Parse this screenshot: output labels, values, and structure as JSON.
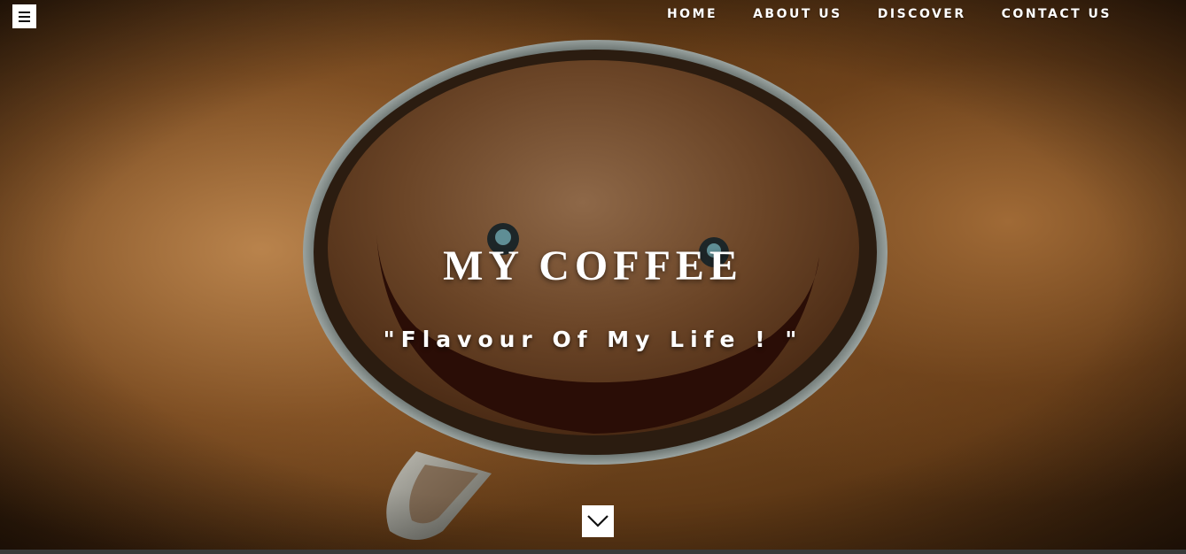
{
  "header": {
    "menu_icon": "hamburger-icon",
    "nav": [
      {
        "label": "HOME"
      },
      {
        "label": "ABOUT US"
      },
      {
        "label": "DISCOVER"
      },
      {
        "label": "CONTACT US"
      }
    ]
  },
  "hero": {
    "title": "MY COFFEE",
    "tagline": "\"Flavour Of My Life ! \"",
    "background_image": "coffee-cup-smiley-image",
    "scroll_icon": "chevron-down-icon"
  },
  "colors": {
    "nav_text": "#ffffff",
    "button_bg": "#ffffff",
    "coffee_brown": "#6b4527"
  }
}
